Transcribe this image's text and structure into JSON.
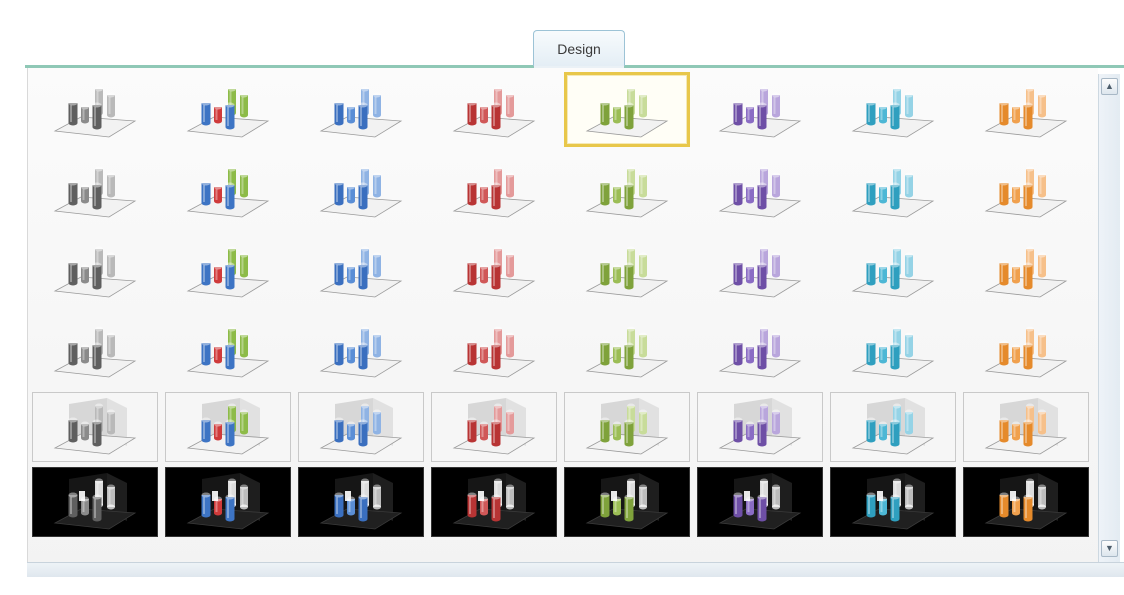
{
  "tab": {
    "label": "Design"
  },
  "scrollbar": {
    "up_icon": "arrow-up-icon",
    "down_icon": "arrow-down-icon"
  },
  "colors": {
    "tab_line": "#8fc8b6",
    "selected_border": "#e8c74a",
    "dark_background": "#000000"
  },
  "gallery": {
    "selected_row": 0,
    "selected_col": 4,
    "palettes": [
      {
        "name": "gray",
        "main": "#5f5f5f",
        "light": "#b9b9b9",
        "accent": "#8a8a8a"
      },
      {
        "name": "multi",
        "main": "#3d74c4",
        "light": "#8dbb48",
        "accent": "#cf3a3a"
      },
      {
        "name": "blue",
        "main": "#3a6fbf",
        "light": "#8fb3e4",
        "accent": "#5a8ed6"
      },
      {
        "name": "red",
        "main": "#b83434",
        "light": "#e49a9a",
        "accent": "#d05858"
      },
      {
        "name": "green",
        "main": "#7fa23b",
        "light": "#c8dc9a",
        "accent": "#9bbd55"
      },
      {
        "name": "purple",
        "main": "#6e4fa6",
        "light": "#b9a6dc",
        "accent": "#8a6cc4"
      },
      {
        "name": "teal",
        "main": "#2f9fbf",
        "light": "#95d3e6",
        "accent": "#4db7d5"
      },
      {
        "name": "orange",
        "main": "#e58a2b",
        "light": "#f6c08a",
        "accent": "#f0a04d"
      }
    ],
    "rows": [
      {
        "style": "plain"
      },
      {
        "style": "plain"
      },
      {
        "style": "plain"
      },
      {
        "style": "plain"
      },
      {
        "style": "boxed"
      },
      {
        "style": "dark"
      }
    ]
  }
}
